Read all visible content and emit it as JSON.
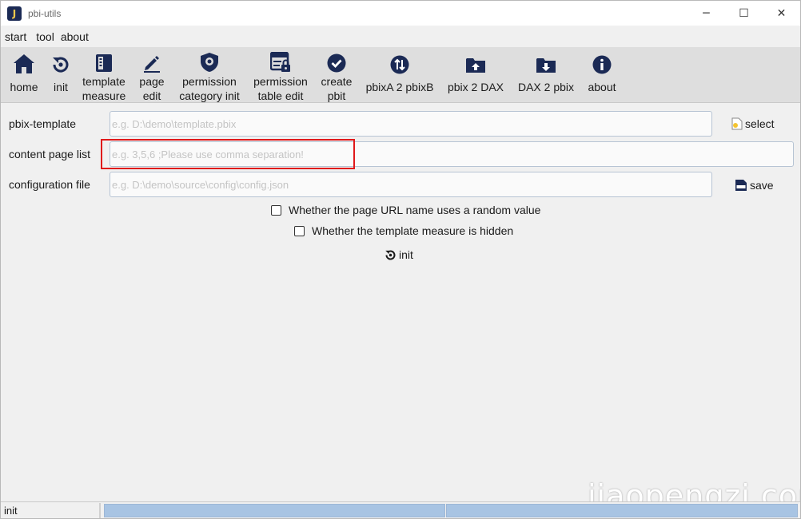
{
  "window": {
    "title": "pbi-utils",
    "app_icon_letter": "J",
    "controls": {
      "minimize": "─",
      "maximize": "☐",
      "close": "✕"
    }
  },
  "menubar": {
    "items": [
      "start",
      "tool",
      "about"
    ]
  },
  "toolbar": {
    "items": [
      {
        "id": "home",
        "icon": "house-icon",
        "label1": "home",
        "label2": ""
      },
      {
        "id": "init",
        "icon": "refresh-icon",
        "label1": "init",
        "label2": ""
      },
      {
        "id": "template-measure",
        "icon": "document-list-icon",
        "label1": "template",
        "label2": "measure"
      },
      {
        "id": "page-edit",
        "icon": "pen-icon",
        "label1": "page",
        "label2": "edit"
      },
      {
        "id": "permission-category-init",
        "icon": "shield-gear-icon",
        "label1": "permission",
        "label2": "category init"
      },
      {
        "id": "permission-table-edit",
        "icon": "table-lock-icon",
        "label1": "permission",
        "label2": "table edit"
      },
      {
        "id": "create-pbit",
        "icon": "check-circle-icon",
        "label1": "create",
        "label2": "pbit"
      },
      {
        "id": "pbixa-2-pbixb",
        "icon": "swap-circle-icon",
        "label1": "pbixA 2 pbixB",
        "label2": ""
      },
      {
        "id": "pbix-2-dax",
        "icon": "folder-upload-icon",
        "label1": "pbix 2 DAX",
        "label2": ""
      },
      {
        "id": "dax-2-pbix",
        "icon": "folder-download-icon",
        "label1": "DAX 2 pbix",
        "label2": ""
      },
      {
        "id": "about",
        "icon": "info-circle-icon",
        "label1": "about",
        "label2": ""
      }
    ]
  },
  "form": {
    "pbix_template": {
      "label": "pbix-template",
      "value": "",
      "placeholder": "e.g. D:\\demo\\template.pbix"
    },
    "content_page_list": {
      "label": "content page list",
      "value": "",
      "placeholder": "e.g. 3,5,6 ;Please use comma separation!"
    },
    "configuration_file": {
      "label": "configuration file",
      "value": "",
      "placeholder": "e.g. D:\\demo\\source\\config\\config.json"
    },
    "select_button": {
      "label": "select",
      "icon": "file-icon"
    },
    "save_button": {
      "label": "save",
      "icon": "json-file-icon"
    },
    "checkbox_random_url": {
      "label": "Whether the page URL name uses a random value",
      "checked": false
    },
    "checkbox_measure_hidden": {
      "label": "Whether the template measure is hidden",
      "checked": false
    },
    "init_button": {
      "label": "init",
      "icon": "refresh-icon"
    }
  },
  "statusbar": {
    "text": "init",
    "progress": 0.0
  },
  "watermark": "jiaopengzi.com",
  "colors": {
    "icon_navy": "#1b2a55",
    "highlight_red": "#e0191b",
    "toolbar_bg": "#dedede",
    "progress_bg": "#a8c4e3"
  }
}
